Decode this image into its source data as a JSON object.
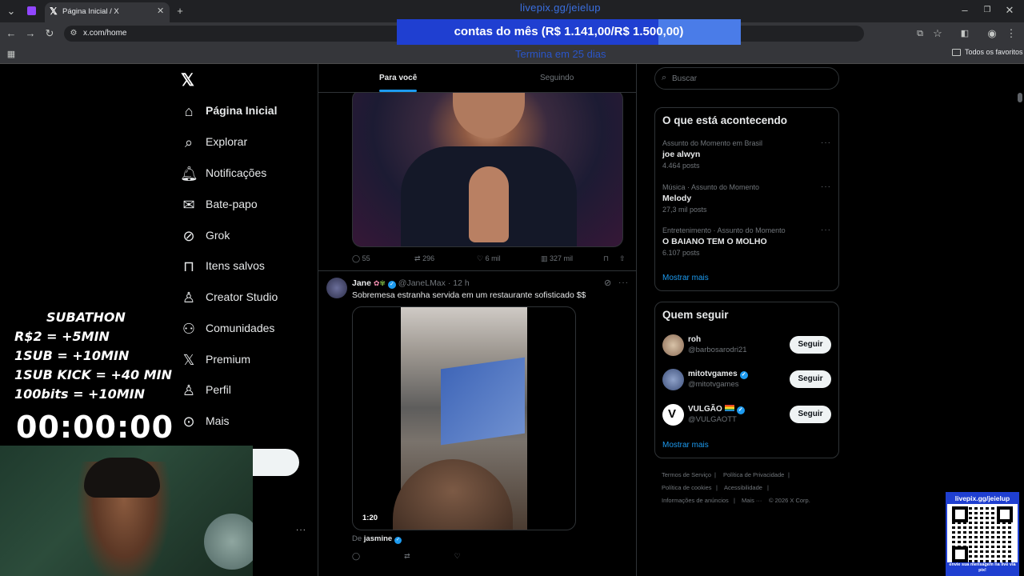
{
  "browser": {
    "tab_title": "Página Inicial / X",
    "url": "x.com/home",
    "bookmarks_folder": "Todos os favoritos"
  },
  "overlay": {
    "donation_link": "livepix.gg/jeielup",
    "goal_text": "contas do mês (R$ 1.141,00/R$ 1.500,00)",
    "goal_progress": 0.76,
    "goal_sub": "Termina em 25 dias",
    "subathon_title": "SUBATHON",
    "subathon_rules": [
      "R$2 = +5MIN",
      "1SUB  =  +10MIN",
      "1SUB KICK = +40 MIN",
      "100bits = +10MIN"
    ],
    "timer": "00:00:00",
    "qr_top": "livepix.gg/jeielup",
    "qr_bottom": "envie sua mensagem na live via pix!"
  },
  "nav": {
    "items": [
      {
        "label": "Página Inicial",
        "icon": "home-icon"
      },
      {
        "label": "Explorar",
        "icon": "search-icon"
      },
      {
        "label": "Notificações",
        "icon": "bell-icon"
      },
      {
        "label": "Bate-papo",
        "icon": "mail-icon"
      },
      {
        "label": "Grok",
        "icon": "grok-icon"
      },
      {
        "label": "Itens salvos",
        "icon": "bookmark-icon"
      },
      {
        "label": "Creator Studio",
        "icon": "creator-icon"
      },
      {
        "label": "Comunidades",
        "icon": "people-icon"
      },
      {
        "label": "Premium",
        "icon": "x-icon"
      },
      {
        "label": "Perfil",
        "icon": "person-icon"
      },
      {
        "label": "Mais",
        "icon": "more-circle-icon"
      }
    ]
  },
  "feed": {
    "tabs": [
      "Para você",
      "Seguindo"
    ],
    "tweet1_actions": {
      "replies": "55",
      "retweets": "296",
      "likes": "6 mil",
      "views": "327 mil"
    },
    "tweet2": {
      "name": "Jane",
      "handle": "@JaneLMax",
      "time": "· 12 h",
      "text": "Sobremesa estranha servida em um restaurante sofisticado $$",
      "duration": "1:20",
      "from_prefix": "De",
      "from_name": "jasmine"
    }
  },
  "right": {
    "search_placeholder": "Buscar",
    "trends_title": "O que está acontecendo",
    "trends": [
      {
        "meta": "Assunto do Momento em Brasil",
        "name": "joe alwyn",
        "posts": "4.464 posts"
      },
      {
        "meta": "Música · Assunto do Momento",
        "name": "Melody",
        "posts": "27,3 mil posts"
      },
      {
        "meta": "Entretenimento · Assunto do Momento",
        "name": "O BAIANO TEM O MOLHO",
        "posts": "6.107 posts"
      }
    ],
    "show_more": "Mostrar mais",
    "follow_title": "Quem seguir",
    "follow": [
      {
        "name": "roh",
        "handle": "@barbosarodri21"
      },
      {
        "name": "mitotvgames",
        "handle": "@mitotvgames"
      },
      {
        "name": "VULGÃO",
        "handle": "@VULGAOTT"
      }
    ],
    "follow_btn": "Seguir",
    "footer": [
      "Termos de Serviço",
      "Política de Privacidade",
      "Política de cookies",
      "Acessibilidade",
      "Informações de anúncios",
      "Mais ···",
      "© 2026 X Corp."
    ]
  }
}
